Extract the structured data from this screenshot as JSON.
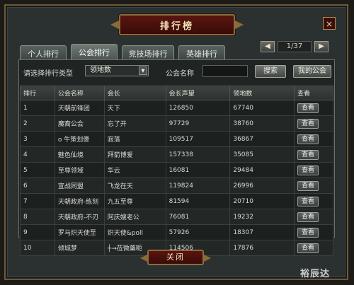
{
  "window": {
    "title": "排行榜",
    "close_icon": "×"
  },
  "tabs": [
    {
      "label": "个人排行"
    },
    {
      "label": "公会排行"
    },
    {
      "label": "竞技场排行"
    },
    {
      "label": "英雄排行"
    }
  ],
  "pager": {
    "prev_icon": "◀",
    "page": "1/37",
    "next_icon": "▶"
  },
  "filter": {
    "type_label": "请选择排行类型",
    "type_value": "领地数",
    "name_label": "公会名称",
    "name_value": "",
    "search_button": "搜索",
    "my_guild_button": "我的公会"
  },
  "table": {
    "headers": [
      "排行",
      "公会名称",
      "会长",
      "会长声望",
      "领地数",
      "查看"
    ],
    "rows": [
      {
        "rank": "1",
        "guild": "天朝前锋团",
        "leader": "天下",
        "prestige": "126850",
        "land": "67740",
        "view": "查看"
      },
      {
        "rank": "2",
        "guild": "魔裔公会",
        "leader": "忘了开",
        "prestige": "97729",
        "land": "38760",
        "view": "查看"
      },
      {
        "rank": "3",
        "guild": "o 牛策划傻",
        "leader": "寂落",
        "prestige": "109517",
        "land": "36867",
        "view": "查看"
      },
      {
        "rank": "4",
        "guild": "魅色仙境",
        "leader": "拜箭博爱",
        "prestige": "157338",
        "land": "35085",
        "view": "查看"
      },
      {
        "rank": "5",
        "guild": "至尊领域",
        "leader": "华云",
        "prestige": "16081",
        "land": "29484",
        "view": "查看"
      },
      {
        "rank": "6",
        "guild": "宣战同盟",
        "leader": "飞龙在天",
        "prestige": "119824",
        "land": "26996",
        "view": "查看"
      },
      {
        "rank": "7",
        "guild": "天朝政府-练刻",
        "leader": "九五至尊",
        "prestige": "81594",
        "land": "20710",
        "view": "查看"
      },
      {
        "rank": "8",
        "guild": "天朝政府-不刃",
        "leader": "阿庆嫂老公",
        "prestige": "76081",
        "land": "19232",
        "view": "查看"
      },
      {
        "rank": "9",
        "guild": "罗马炽天使至",
        "leader": "炽天使&poll",
        "prestige": "57926",
        "land": "18307",
        "view": "查看"
      },
      {
        "rank": "10",
        "guild": "倾城梦",
        "leader": "┼→莅微藥呃",
        "prestige": "114506",
        "land": "17876",
        "view": "查看"
      }
    ]
  },
  "footer": {
    "close_label": "关闭"
  },
  "watermark": "裕辰达"
}
